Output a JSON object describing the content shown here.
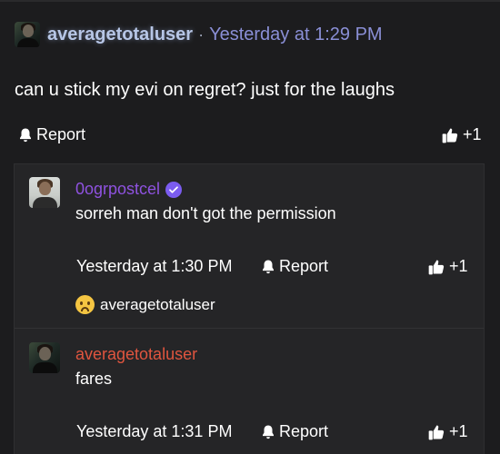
{
  "post": {
    "author": "averagetotaluser",
    "separator": "·",
    "timestamp": "Yesterday at 1:29 PM",
    "body": "can u stick my evi on regret? just for the laughs",
    "report_label": "Report",
    "like_label": "+1"
  },
  "replies": [
    {
      "author": "0ogrpostcel",
      "author_color": "#8f52e0",
      "verified": true,
      "text": "sorreh man don't got the permission",
      "timestamp": "Yesterday at 1:30 PM",
      "report_label": "Report",
      "like_label": "+1",
      "reaction": {
        "emoji": "sad-face",
        "user": "averagetotaluser"
      }
    },
    {
      "author": "averagetotaluser",
      "author_color": "#e0553f",
      "verified": false,
      "text": "fares",
      "timestamp": "Yesterday at 1:31 PM",
      "report_label": "Report",
      "like_label": "+1"
    }
  ],
  "colors": {
    "background": "#1c1c1e",
    "thread_background": "#252527",
    "post_author": "#b7c6e6",
    "post_time": "#8a8fd6",
    "verified_badge": "#7b5cf0"
  }
}
